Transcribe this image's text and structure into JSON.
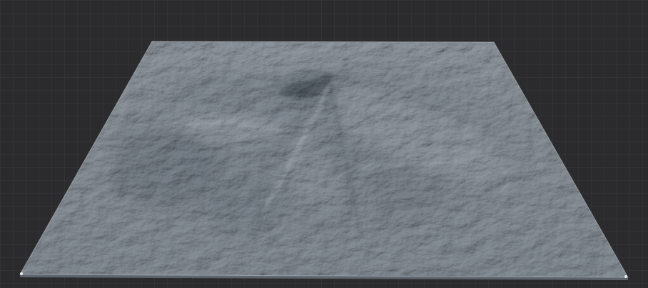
{
  "viewport": {
    "background": "#2b2b2d",
    "grid_minor_color": "#3a3a3d",
    "grid_major_color": "#444447"
  },
  "terrain": {
    "base_color": "#8f979e",
    "light_color": "#c9ced3",
    "shadow_color": "#3e4650",
    "deep_shadow_color": "#1f252c"
  },
  "icons": [
    "grid-floor",
    "terrain-mesh"
  ]
}
